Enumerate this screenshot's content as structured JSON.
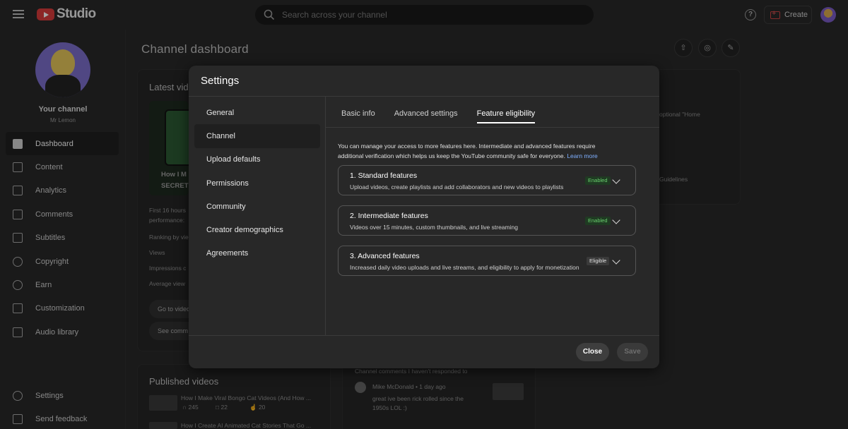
{
  "topbar": {
    "logo_text": "Studio",
    "search_placeholder": "Search across your channel",
    "help_label": "?",
    "create_label": "Create"
  },
  "sidebar": {
    "your_channel": "Your channel",
    "channel_name": "Mr Lemon",
    "items": [
      {
        "label": "Dashboard",
        "icon": "dashboard-icon",
        "active": true
      },
      {
        "label": "Content",
        "icon": "content-icon"
      },
      {
        "label": "Analytics",
        "icon": "analytics-icon"
      },
      {
        "label": "Comments",
        "icon": "comments-icon"
      },
      {
        "label": "Subtitles",
        "icon": "subtitles-icon"
      },
      {
        "label": "Copyright",
        "icon": "copyright-icon"
      },
      {
        "label": "Earn",
        "icon": "earn-icon"
      },
      {
        "label": "Customization",
        "icon": "customization-icon"
      },
      {
        "label": "Audio library",
        "icon": "audio-library-icon"
      }
    ],
    "settings_label": "Settings",
    "feedback_label": "Send feedback"
  },
  "dashboard": {
    "title": "Channel dashboard",
    "latest_video_title": "Latest vide",
    "thumb_caption_1": "How I M",
    "thumb_caption_2": "SECRET",
    "perf_line1": "First 16 hours",
    "perf_line2": "performance:",
    "ranking": "Ranking by vie",
    "views": "Views",
    "impressions": "Impressions c",
    "avg_view": "Average view",
    "go_to_video": "Go to video",
    "see_comments": "See comm",
    "published_title": "Published videos",
    "pub_videos": [
      {
        "title": "How I Make Viral Bongo Cat Videos (And How ...",
        "views": "245",
        "comments": "22",
        "likes": "20"
      },
      {
        "title": "How I Create AI Animated Cat Stories That Go ..."
      }
    ],
    "right_snip_1": "optional \"Home",
    "right_snip_2": "Guidelines",
    "comments_header": "Channel comments I haven't responded to",
    "comment_author": "Mike McDonald",
    "comment_time": "1 day ago",
    "comment_text_1": "great ive been rick rolled since the",
    "comment_text_2": "1950s LOL :)"
  },
  "settings_modal": {
    "title": "Settings",
    "nav": [
      {
        "label": "General"
      },
      {
        "label": "Channel",
        "active": true
      },
      {
        "label": "Upload defaults"
      },
      {
        "label": "Permissions"
      },
      {
        "label": "Community"
      },
      {
        "label": "Creator demographics"
      },
      {
        "label": "Agreements"
      }
    ],
    "tabs": [
      {
        "label": "Basic info"
      },
      {
        "label": "Advanced settings"
      },
      {
        "label": "Feature eligibility",
        "active": true
      }
    ],
    "description": "You can manage your access to more features here. Intermediate and advanced features require additional verification which helps us keep the YouTube community safe for everyone.",
    "learn_more": "Learn more",
    "features": [
      {
        "title": "1. Standard features",
        "desc": "Upload videos, create playlists and add collaborators and new videos to playlists",
        "status": "Enabled"
      },
      {
        "title": "2. Intermediate features",
        "desc": "Videos over 15 minutes, custom thumbnails, and live streaming",
        "status": "Enabled"
      },
      {
        "title": "3. Advanced features",
        "desc": "Increased daily video uploads and live streams, and eligibility to apply for monetization",
        "status": "Eligible"
      }
    ],
    "close_label": "Close",
    "save_label": "Save"
  },
  "colors": {
    "background": "#282828",
    "enabled_badge": "#6ad06f",
    "link": "#7fb0ff",
    "brand_red": "#d83b3b"
  }
}
